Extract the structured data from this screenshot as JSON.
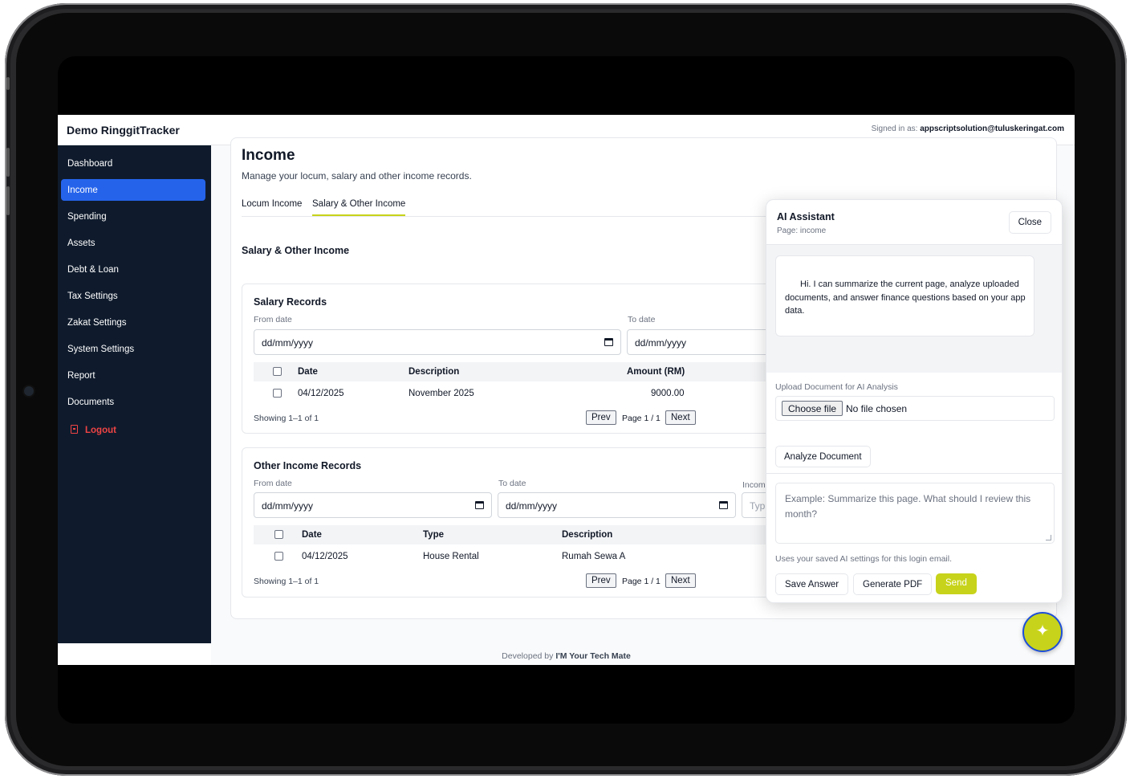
{
  "app": {
    "brand": "Demo RinggitTracker",
    "signed_in_label": "Signed in as:",
    "signed_in_email": "appscriptsolution@tuluskeringat.com"
  },
  "sidebar": {
    "items": [
      {
        "label": "Dashboard"
      },
      {
        "label": "Income"
      },
      {
        "label": "Spending"
      },
      {
        "label": "Assets"
      },
      {
        "label": "Debt & Loan"
      },
      {
        "label": "Tax Settings"
      },
      {
        "label": "Zakat Settings"
      },
      {
        "label": "System Settings"
      },
      {
        "label": "Report"
      },
      {
        "label": "Documents"
      },
      {
        "label": "Logout"
      }
    ],
    "active": "Income",
    "active_color": "#2563eb",
    "logout_color": "#ef4444",
    "logout_icon": "logout-icon"
  },
  "page": {
    "title": "Income",
    "subtitle": "Manage your locum, salary and other income records.",
    "tabs": [
      {
        "label": "Locum Income"
      },
      {
        "label": "Salary & Other Income"
      }
    ],
    "active_tab": "Salary & Other Income",
    "section_title": "Salary & Other Income"
  },
  "salary": {
    "title": "Salary Records",
    "from_label": "From date",
    "to_label": "To date",
    "from_value": "dd/mm/yyyy",
    "to_value": "dd/mm/yyyy",
    "columns": [
      "Date",
      "Description",
      "Amount (RM)"
    ],
    "rows": [
      {
        "date": "04/12/2025",
        "description": "November 2025",
        "amount": "9000.00"
      }
    ],
    "showing": "Showing 1–1 of 1",
    "prev": "Prev",
    "page": "Page 1 / 1",
    "next": "Next"
  },
  "other": {
    "title": "Other Income Records",
    "from_label": "From date",
    "to_label": "To date",
    "type_label": "Incom",
    "from_value": "dd/mm/yyyy",
    "to_value": "dd/mm/yyyy",
    "type_placeholder": "Typ",
    "columns": [
      "Date",
      "Type",
      "Description"
    ],
    "rows": [
      {
        "date": "04/12/2025",
        "type": "House Rental",
        "description": "Rumah Sewa A"
      }
    ],
    "showing": "Showing 1–1 of 1",
    "prev": "Prev",
    "page": "Page 1 / 1",
    "next": "Next"
  },
  "footer": {
    "prefix": "Developed by",
    "name": "I'M Your Tech Mate"
  },
  "ai": {
    "title": "AI Assistant",
    "page_label": "Page: income",
    "close": "Close",
    "greeting": "Hi. I can summarize the current page, analyze uploaded documents, and answer finance questions based on your app data.",
    "upload_label": "Upload Document for AI Analysis",
    "choose_file": "Choose file",
    "no_file": "No file chosen",
    "analyze": "Analyze Document",
    "placeholder": "Example: Summarize this page. What should I review this month?",
    "note": "Uses your saved AI settings for this login email.",
    "save_answer": "Save Answer",
    "generate_pdf": "Generate PDF",
    "send": "Send",
    "accent_color": "#c7d31a",
    "fab_icon": "sparkle-icon"
  }
}
